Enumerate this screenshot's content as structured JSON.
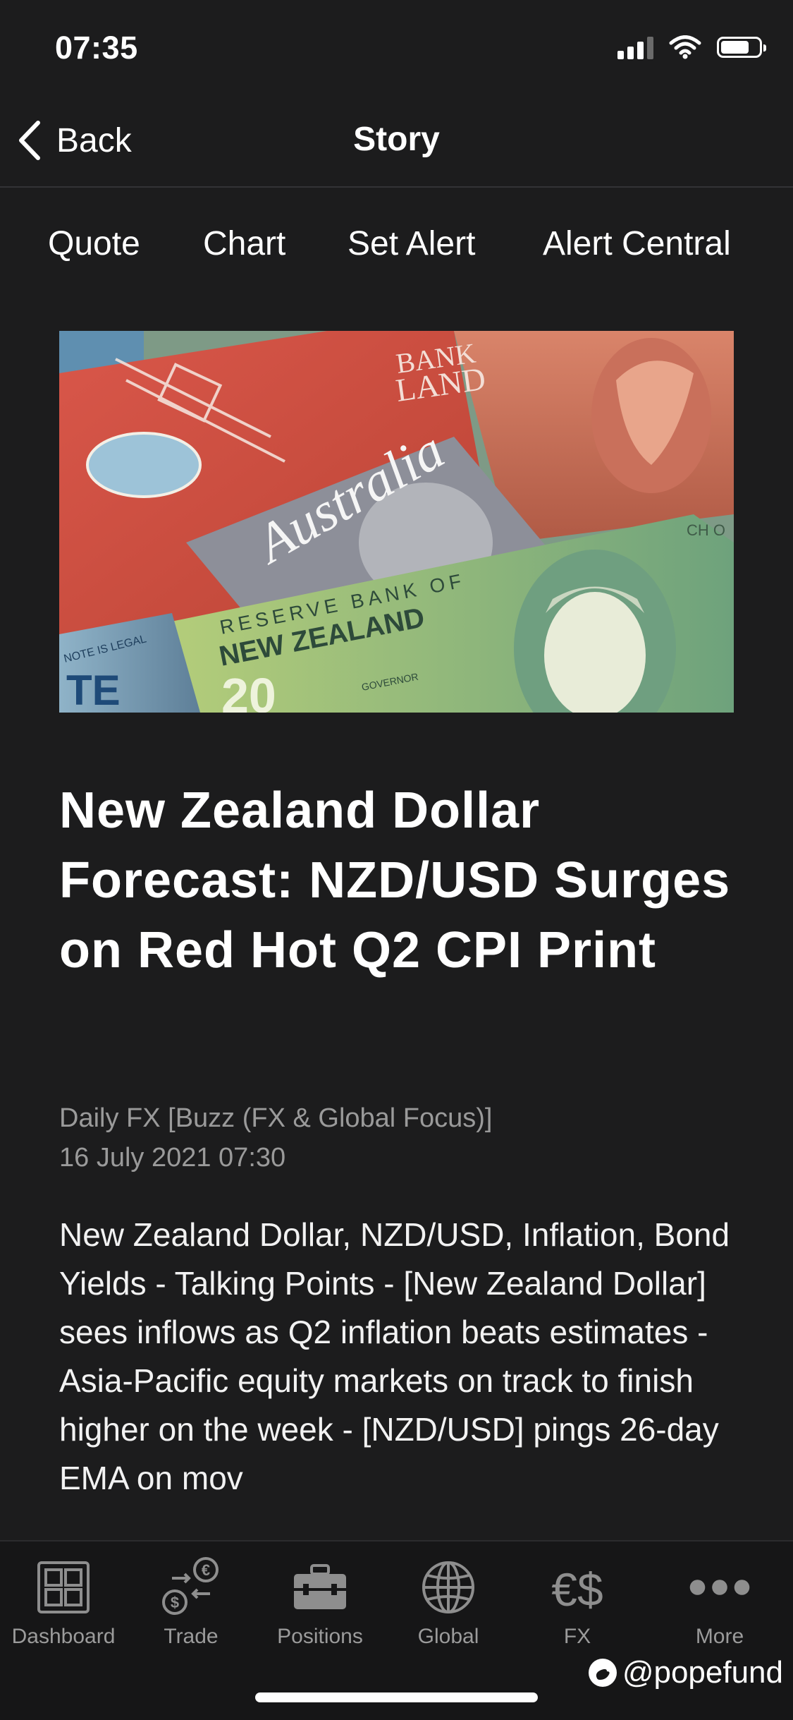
{
  "status_bar": {
    "time": "07:35",
    "signal_icon": "cellular-signal-icon",
    "wifi_icon": "wifi-icon",
    "battery_icon": "battery-icon",
    "battery_level": 0.75
  },
  "nav": {
    "back_label": "Back",
    "back_icon": "chevron-left-icon",
    "title": "Story"
  },
  "actions": [
    "Quote",
    "Chart",
    "Set Alert",
    "Alert Central"
  ],
  "hero": {
    "image": "banknotes-photo",
    "text_bank_top": "BANK",
    "text_land": "LAND",
    "text_australia": "Australia",
    "text_reserve": "RESERVE BANK OF",
    "text_nz": "NEW ZEALAND",
    "text_governor": "GOVERNOR",
    "text_twenty": "20",
    "text_ch": "CH O",
    "text_legal": "NOTE IS LEGAL",
    "text_te": "TE"
  },
  "article": {
    "headline": "New Zealand Dollar Forecast: NZD/USD Surges on Red Hot Q2 CPI Print",
    "source": "Daily FX [Buzz (FX & Global Focus)]",
    "date": "16 July 2021 07:30",
    "summary": "New Zealand Dollar, NZD/USD, Inflation, Bond Yields - Talking Points - [New Zealand Dollar] sees inflows as Q2 inflation beats estimates - Asia-Pacific equity markets on track to finish higher on the week - [NZD/USD] pings 26-day EMA on mov"
  },
  "tabs": [
    {
      "label": "Dashboard",
      "icon": "dashboard-grid-icon"
    },
    {
      "label": "Trade",
      "icon": "trade-currency-exchange-icon"
    },
    {
      "label": "Positions",
      "icon": "briefcase-icon"
    },
    {
      "label": "Global",
      "icon": "globe-icon"
    },
    {
      "label": "FX",
      "icon": "euro-dollar-icon"
    },
    {
      "label": "More",
      "icon": "more-dots-icon"
    }
  ],
  "watermark": {
    "text": "@popefund",
    "logo_icon": "weibo-logo-icon"
  },
  "colors": {
    "background": "#1c1c1d",
    "tab_bar": "#161617",
    "muted_text": "#9a9a9a",
    "tab_icon": "#8e8e8e"
  }
}
